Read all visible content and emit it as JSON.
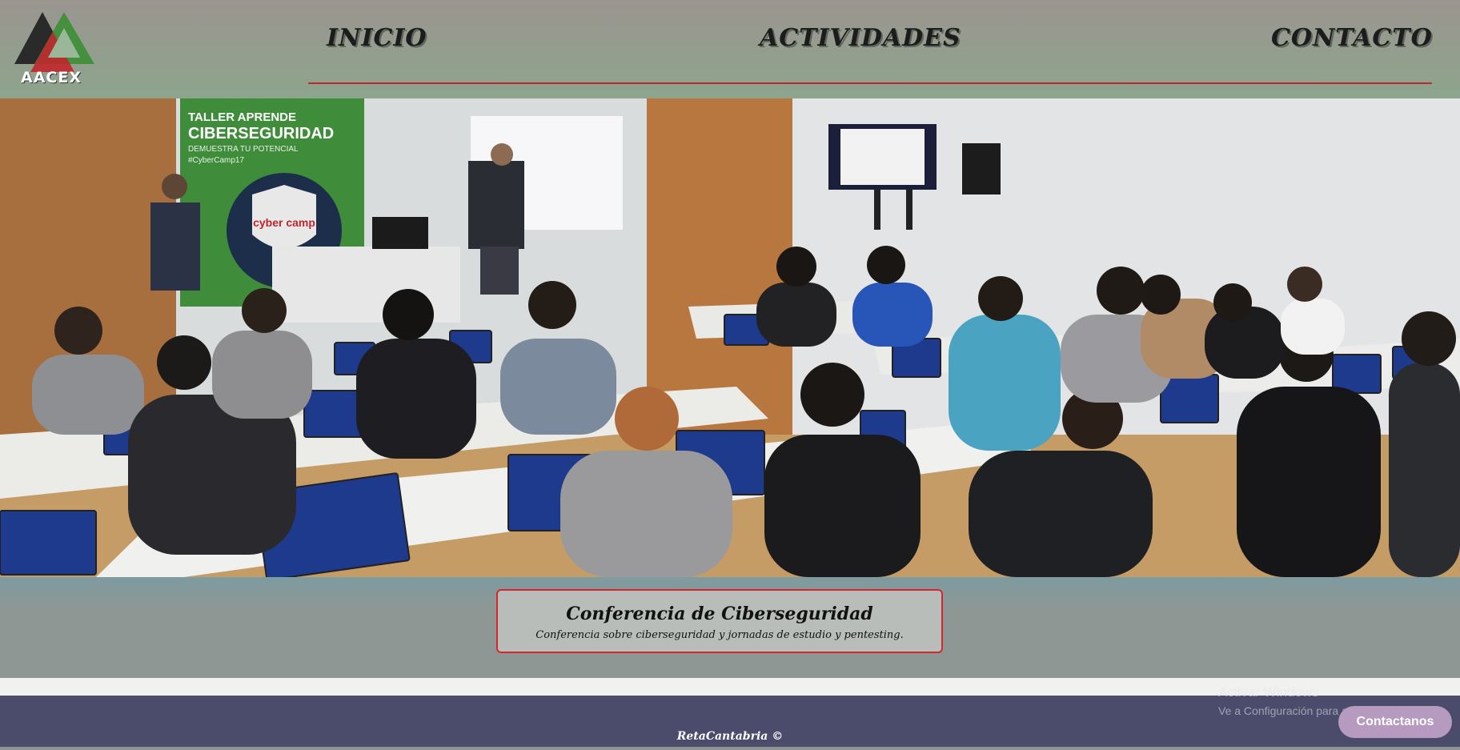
{
  "header": {
    "logo_text": "AACEX",
    "nav": {
      "inicio": "INICIO",
      "actividades": "ACTIVIDADES",
      "contacto": "CONTACTO"
    }
  },
  "hero": {
    "banner_line1": "TALLER APRENDE",
    "banner_line2": "CIBERSEGURIDAD",
    "banner_line3": "DEMUESTRA TU POTENCIAL",
    "banner_tag": "#CyberCamp17",
    "badge_text": "cyber camp"
  },
  "caption": {
    "title": "Conferencia de Ciberseguridad",
    "subtitle": "Conferencia sobre ciberseguridad y jornadas de estudio y pentesting."
  },
  "footer": {
    "text": "RetaCantabria ©"
  },
  "windows_watermark": {
    "title": "Activar Windows",
    "subtitle": "Ve a Configuración para activar Windows."
  },
  "contact_button": {
    "label": "Contactanos"
  },
  "colors": {
    "accent_red": "#c0262d",
    "footer_bg": "#4b4c6b",
    "contact_button": "#b69ac0"
  }
}
